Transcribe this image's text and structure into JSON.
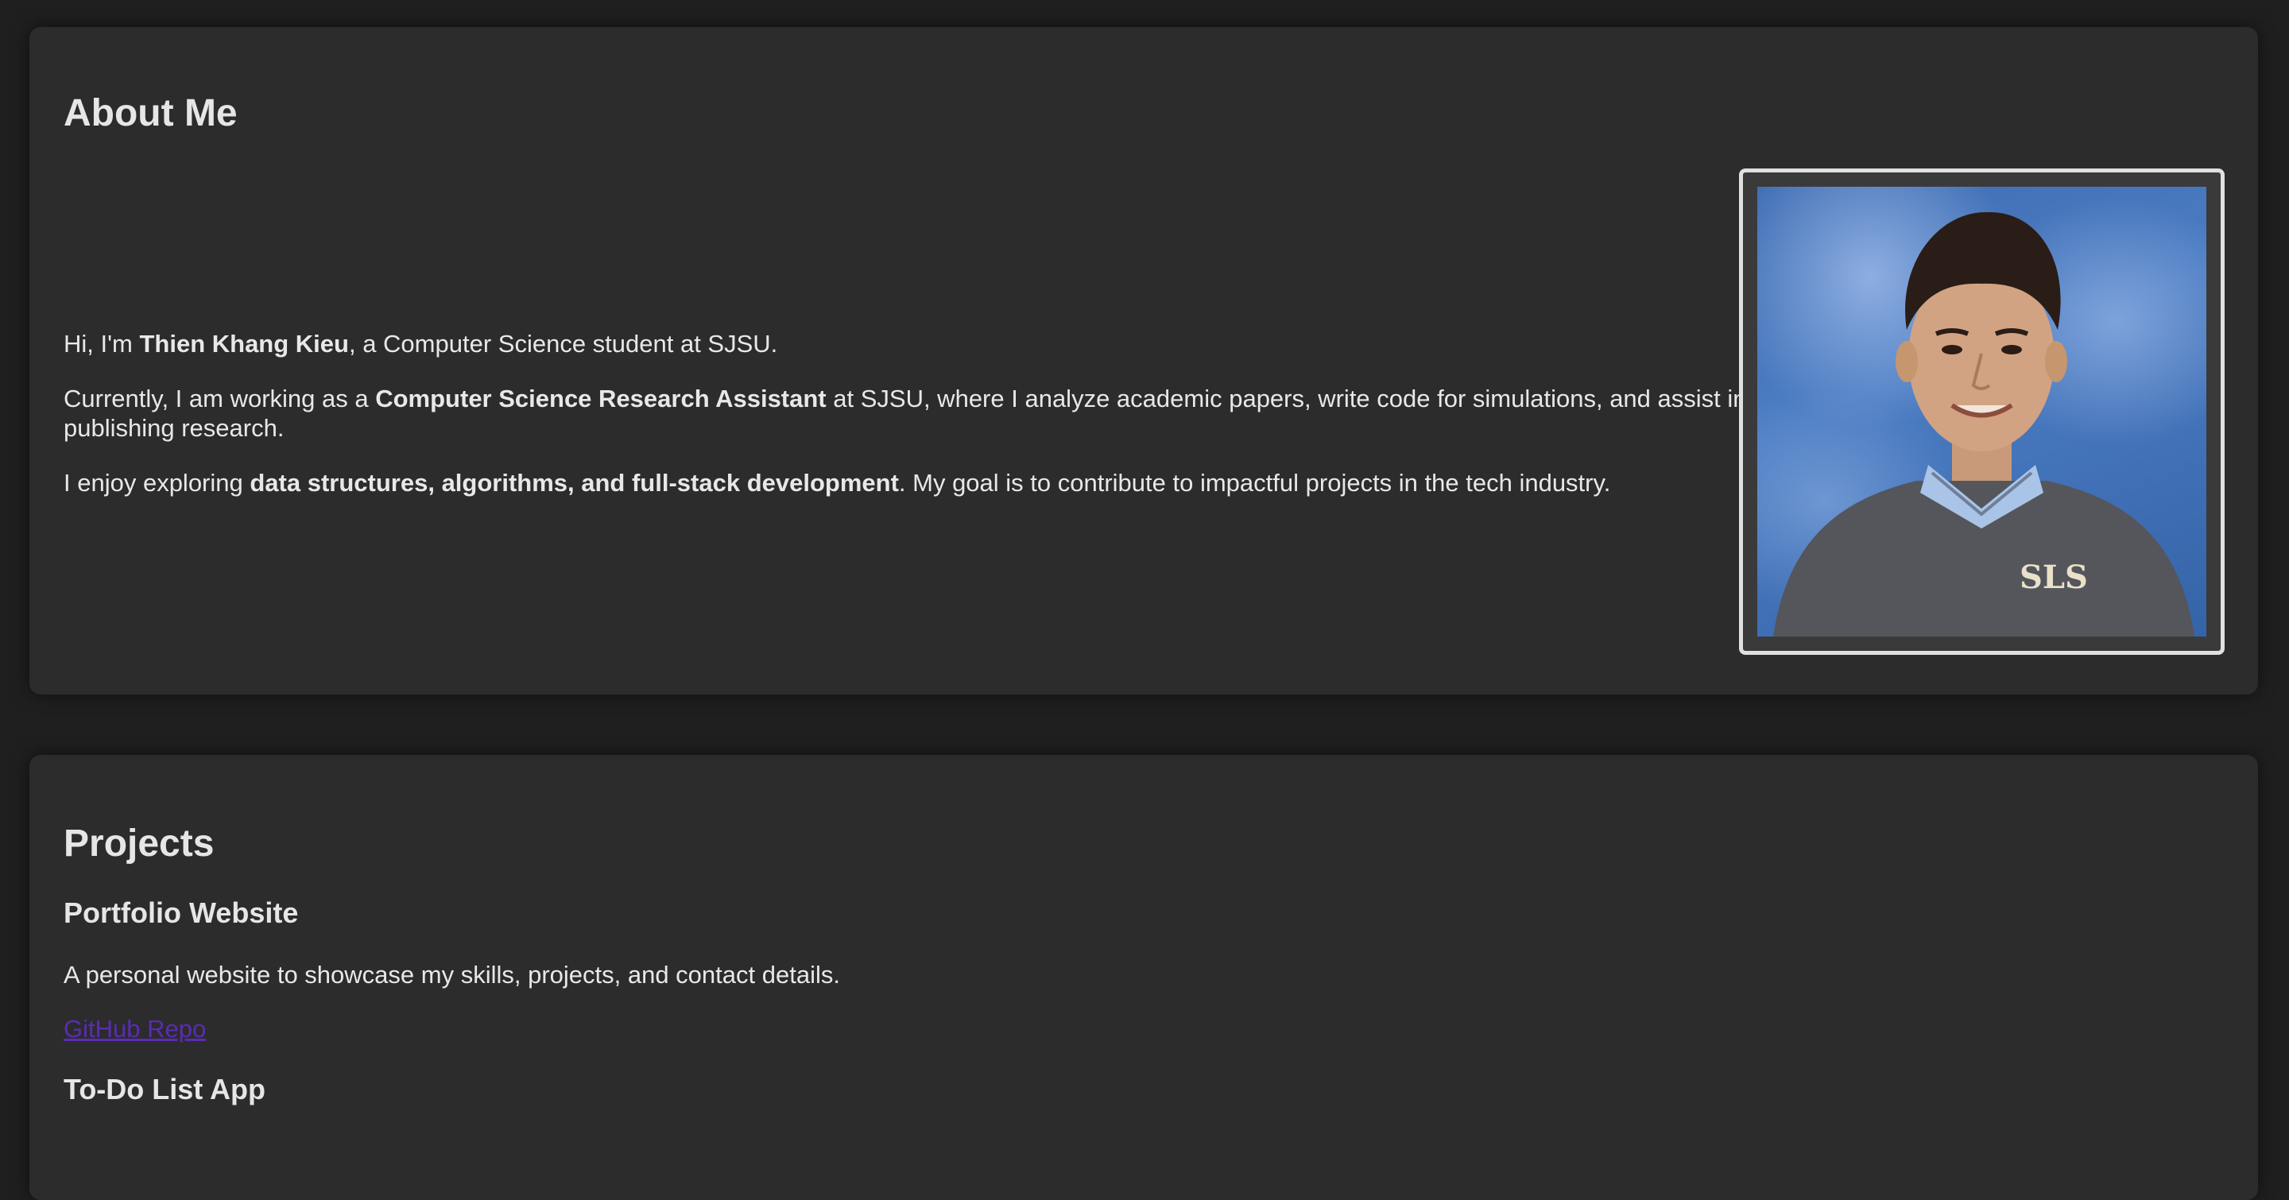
{
  "about": {
    "heading": "About Me",
    "intro_prefix": "Hi, I'm ",
    "intro_name": "Thien Khang Kieu",
    "intro_suffix": ", a Computer Science student at SJSU.",
    "work_prefix": "Currently, I am working as a ",
    "work_role": "Computer Science Research Assistant",
    "work_suffix": " at SJSU, where I analyze academic papers, write code for simulations, and assist in publishing research.",
    "interest_prefix": "I enjoy exploring ",
    "interest_topics": "data structures, algorithms, and full-stack development",
    "interest_suffix": ". My goal is to contribute to impactful projects in the tech industry.",
    "photo_icon": "profile-photo"
  },
  "projects": {
    "heading": "Projects",
    "items": [
      {
        "title": "Portfolio Website",
        "description": "A personal website to showcase my skills, projects, and contact details.",
        "link_label": "GitHub Repo"
      },
      {
        "title": "To-Do List App"
      }
    ]
  },
  "colors": {
    "page_bg": "#1f1f1f",
    "card_bg": "#2c2c2c",
    "text": "#e6e6e6",
    "link": "#5b2bb5",
    "photo_border": "#e0e0e0"
  }
}
